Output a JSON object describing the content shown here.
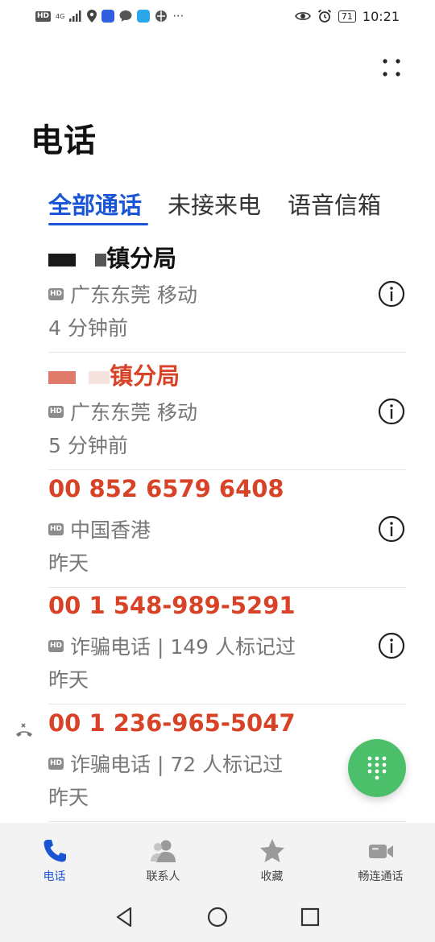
{
  "status_bar": {
    "hd": "HD",
    "network": "4G",
    "battery": "71",
    "time": "10:21"
  },
  "page_title": "电话",
  "tabs": [
    {
      "label": "全部通话",
      "active": true
    },
    {
      "label": "未接来电",
      "active": false
    },
    {
      "label": "语音信箱",
      "active": false
    }
  ],
  "calls": [
    {
      "name": "镇分局",
      "missed": false,
      "hd": "HD",
      "location": "广东东莞 移动",
      "time": "4 分钟前"
    },
    {
      "name": "镇分局",
      "missed": true,
      "hd": "HD",
      "location": "广东东莞 移动",
      "time": "5 分钟前"
    },
    {
      "name": "00 852 6579 6408",
      "missed": true,
      "hd": "HD",
      "location": "中国香港",
      "time": "昨天"
    },
    {
      "name": "00 1 548-989-5291",
      "missed": true,
      "hd": "HD",
      "location": "诈骗电话 | 149 人标记过",
      "time": "昨天"
    },
    {
      "name": "00 1 236-965-5047",
      "missed": true,
      "hd": "HD",
      "location": "诈骗电话 | 72 人标记过",
      "time": "昨天"
    }
  ],
  "bottom_nav": [
    {
      "label": "电话",
      "icon": "phone-icon",
      "active": true
    },
    {
      "label": "联系人",
      "icon": "contacts-icon",
      "active": false
    },
    {
      "label": "收藏",
      "icon": "star-icon",
      "active": false
    },
    {
      "label": "畅连通话",
      "icon": "video-call-icon",
      "active": false
    }
  ],
  "colors": {
    "accent": "#1a55d6",
    "missed": "#d84328",
    "fab": "#4cbf6a",
    "nav_bg": "#f3f3f3"
  }
}
